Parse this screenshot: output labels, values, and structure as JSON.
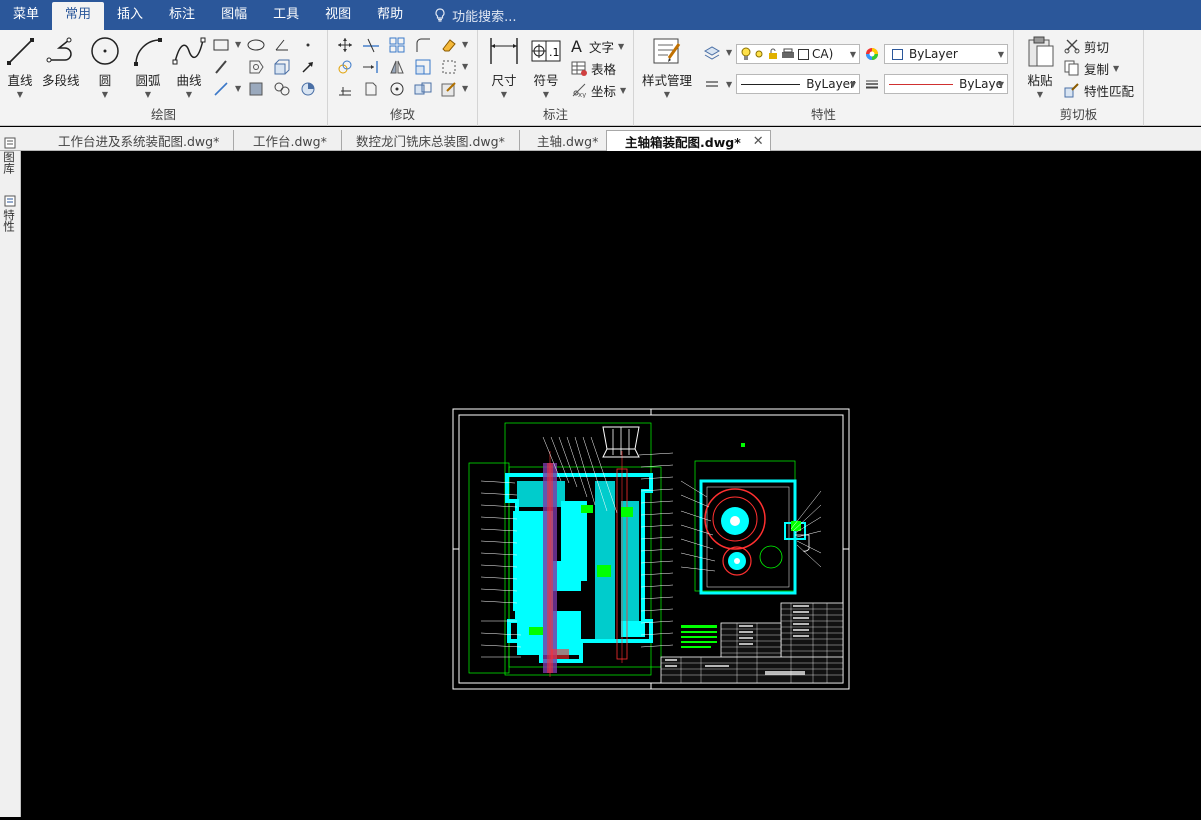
{
  "menubar": {
    "items": [
      "菜单",
      "常用",
      "插入",
      "标注",
      "图幅",
      "工具",
      "视图",
      "帮助"
    ],
    "active": "常用",
    "search_placeholder": "功能搜索..."
  },
  "ribbon": {
    "draw": {
      "title": "绘图",
      "line": "直线",
      "polyline": "多段线",
      "circle": "圆",
      "arc": "圆弧",
      "curve": "曲线"
    },
    "modify": {
      "title": "修改"
    },
    "annotate": {
      "title": "标注",
      "dimension": "尺寸",
      "symbol": "符号",
      "text": "文字",
      "table": "表格",
      "coordinate": "坐标"
    },
    "properties": {
      "title": "特性",
      "style_manager": "样式管理",
      "layer_value": "CA)",
      "color_value": "ByLayer",
      "linetype_value": "ByLayer",
      "lineweight_value": "ByLaye"
    },
    "clipboard": {
      "title": "剪切板",
      "paste": "粘贴",
      "cut": "剪切",
      "copy": "复制",
      "match": "特性匹配"
    }
  },
  "tabs": [
    {
      "label": "工作台进及系统装配图.dwg*"
    },
    {
      "label": "工作台.dwg*"
    },
    {
      "label": "数控龙门铣床总装图.dwg*"
    },
    {
      "label": "主轴.dwg*"
    },
    {
      "label": "主轴箱装配图.dwg*",
      "active": true
    }
  ],
  "sidebar": {
    "library": "图库",
    "properties": "特性"
  },
  "colors": {
    "menubar": "#2b579a",
    "ribbon": "#f3f3f3",
    "canvas": "#000000",
    "cyan": "#00ffff",
    "green": "#00ff00",
    "red": "#ff3030"
  }
}
